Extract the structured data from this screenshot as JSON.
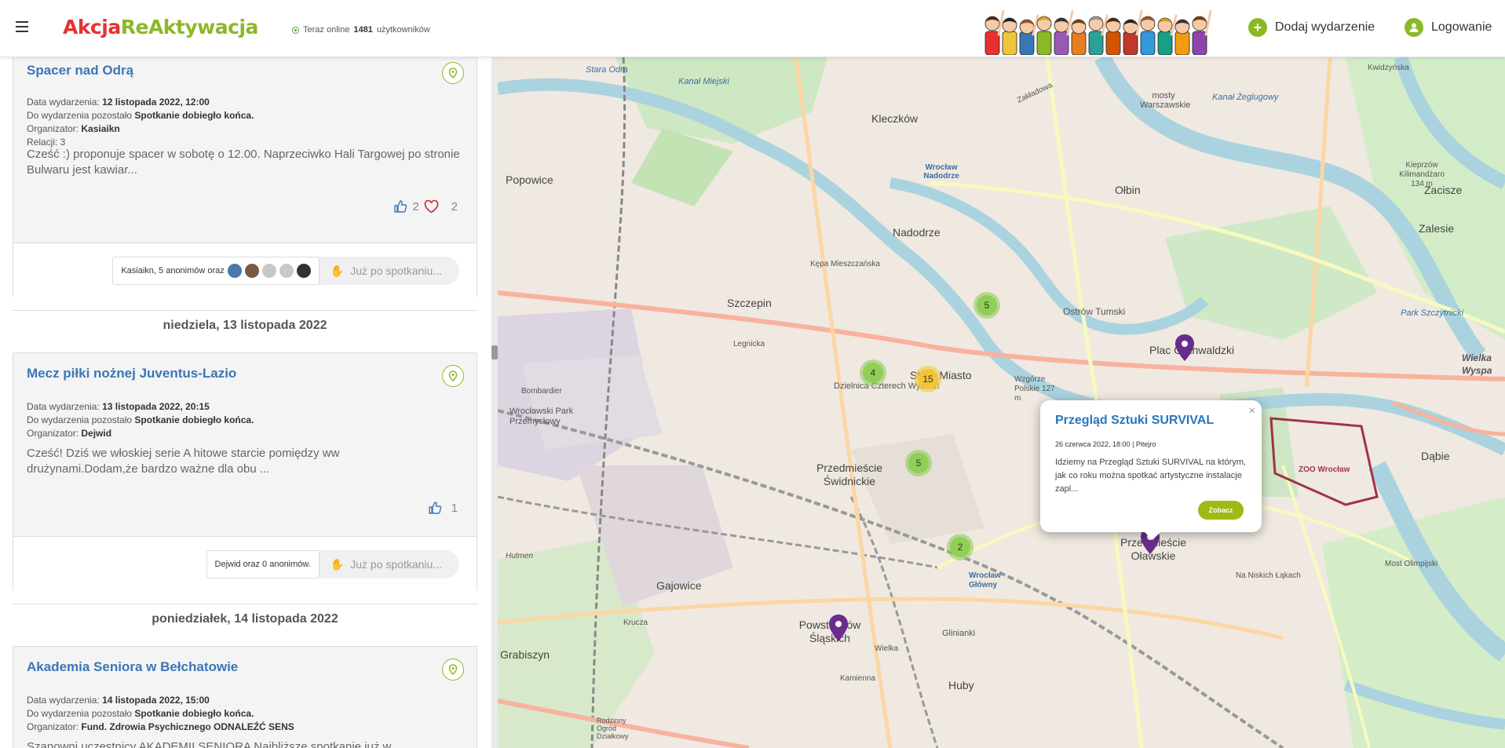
{
  "header": {
    "logo_part1": "Akcja",
    "logo_part2": "ReAktywacja",
    "online_prefix": "Teraz online",
    "online_count": "1481",
    "online_suffix": "użytkowników",
    "add_event": "Dodaj wydarzenie",
    "login": "Logowanie"
  },
  "events": [
    {
      "title": "Spacer nad Odrą",
      "date_label": "Data wydarzenia:",
      "date": "12 listopada 2022, 12:00",
      "remaining_label": "Do wydarzenia pozostało",
      "remaining": "Spotkanie dobiegło końca.",
      "organizer_label": "Organizator:",
      "organizer": "Kasiaikn",
      "relations": "Relacji: 3",
      "description": "Cześć :) proponuje spacer w sobotę o 12.00. Naprzeciwko Hali Targowej po stronie Bulwaru jest kawiar...",
      "like_count": "2",
      "heart_count": "2",
      "attendees": "Kasiaikn, 5 anonimów oraz",
      "after_label": "Już po spotkaniu..."
    },
    {
      "title": "Mecz piłki nożnej Juventus-Lazio",
      "date_label": "Data wydarzenia:",
      "date": "13 listopada 2022, 20:15",
      "remaining_label": "Do wydarzenia pozostało",
      "remaining": "Spotkanie dobiegło końca.",
      "organizer_label": "Organizator:",
      "organizer": "Dejwid",
      "description": "Cześć! Dziś we włoskiej serie A hitowe starcie pomiędzy ww drużynami.Dodam,że bardzo ważne dla obu ...",
      "like_count": "1",
      "attendees": "Dejwid oraz 0 anonimów.",
      "after_label": "Już po spotkaniu..."
    },
    {
      "title": "Akademia Seniora w Bełchatowie",
      "date_label": "Data wydarzenia:",
      "date": "14 listopada 2022, 15:00",
      "remaining_label": "Do wydarzenia pozostało",
      "remaining": "Spotkanie dobiegło końca.",
      "organizer_label": "Organizator:",
      "organizer": "Fund. Zdrowia Psychicznego ODNALEŹĆ SENS",
      "description": "Szanowni uczestnicy AKADEMII SENIORA Najbliższe spotkanie już w..."
    }
  ],
  "days": [
    "niedziela, 13 listopada 2022",
    "poniedziałek, 14 listopada 2022"
  ],
  "map": {
    "labels": [
      "Stara Odra",
      "Kanał Miejski",
      "Kleczków",
      "mosty Warszawskie",
      "Kwidzyńska",
      "Zakładowa",
      "Kanał Żeglugowy",
      "Popowice",
      "Wrocław Nadodrze",
      "Ołbin",
      "Zacisze",
      "Kieprzów Kilimandżaro 134 m",
      "Zalesie",
      "Nadodrze",
      "Kępa Mieszczańska",
      "Szczepin",
      "Ostrów Tumski",
      "Plac Grunwaldzki",
      "Park Szczytnicki",
      "Legnicka",
      "Stare Miasto",
      "Dzielnica Czterech Wyznań",
      "Wzgórze Polskie 127 m",
      "Wielka Wyspa",
      "Bombardier",
      "Wrocławski Park Przemysłowy",
      "Przedmieście Świdnickie",
      "ZOO Wrocław",
      "Dąbie",
      "Przedmieście Oławskie",
      "Na Niskich Łąkach",
      "Most Olimpijski",
      "Hutmen",
      "Gajowice",
      "Wrocław Główny",
      "Powstańców Śląskich",
      "Glinianki",
      "Krucza",
      "Grabiszyn",
      "Huby",
      "Kamienna",
      "Wielka",
      "Rodzinny Ogród Działkowy"
    ],
    "clusters": [
      "5",
      "4",
      "15",
      "5",
      "2"
    ],
    "popup": {
      "title": "Przegląd Sztuki SURVIVAL",
      "meta": "26 czerwca 2022, 18:00 | Pitejro",
      "text": "Idziemy na Przegląd Sztuki SURVIVAL na którym, jak co roku można spotkać artystyczne instalacje zapl...",
      "button": "Zobacz",
      "close": "×"
    }
  },
  "colors": {
    "accent": "#8cb826",
    "link": "#3a77b5",
    "logo_red": "#e8312f",
    "pin": "#6a2c8c"
  }
}
